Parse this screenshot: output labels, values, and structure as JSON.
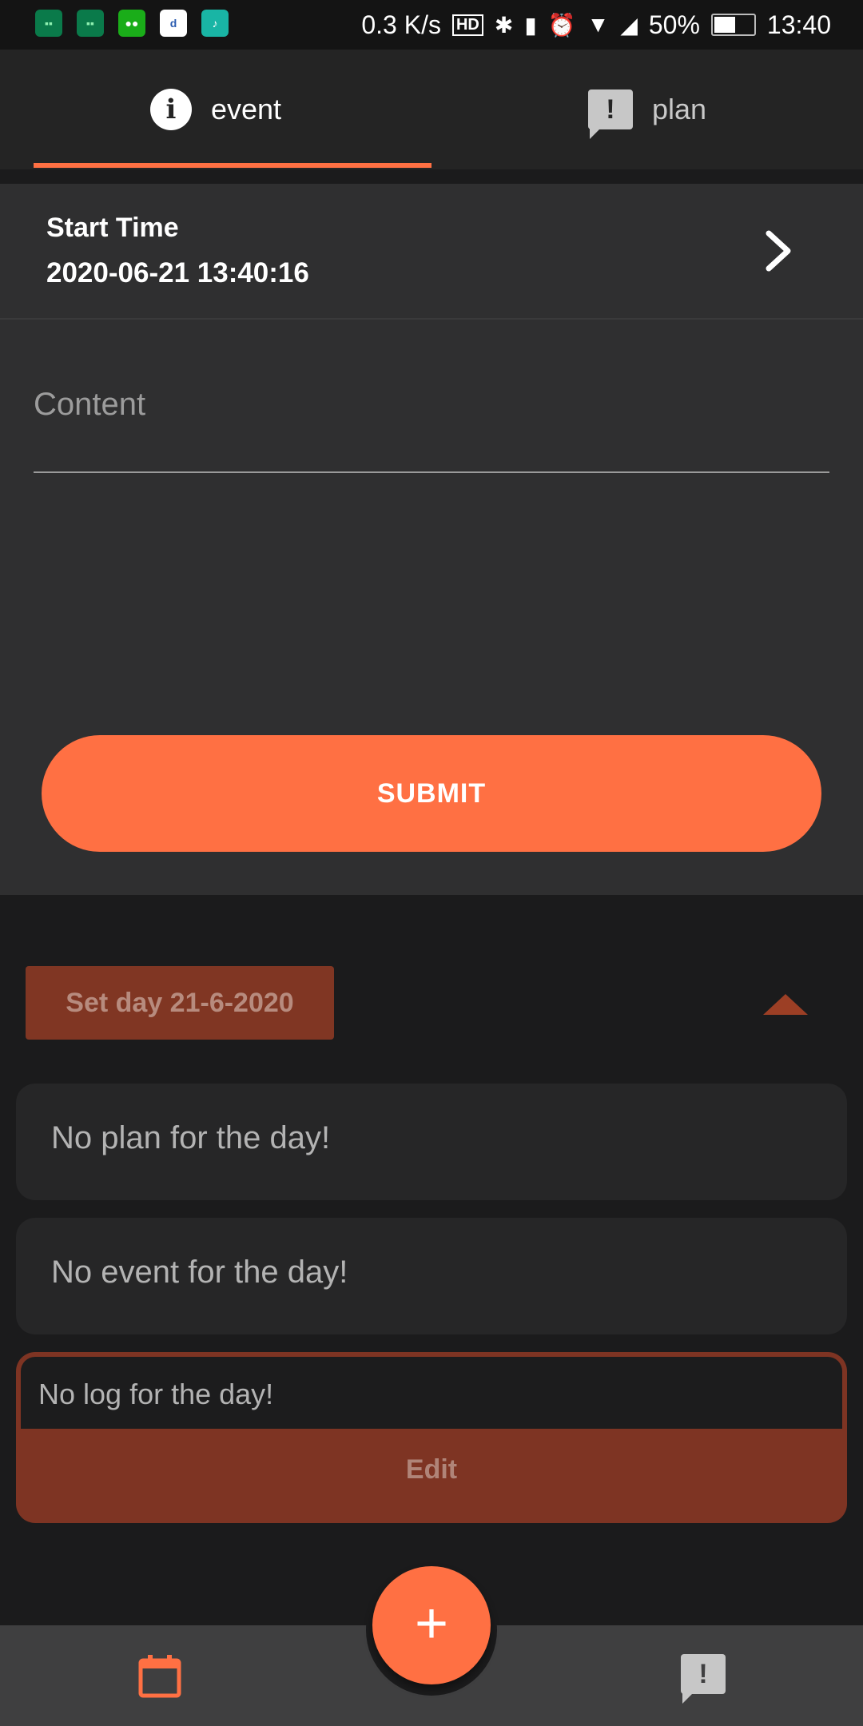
{
  "status_bar": {
    "speed": "0.3 K/s",
    "hd": "HD",
    "battery": "50%",
    "time": "13:40"
  },
  "tabs": [
    {
      "label": "event",
      "icon": "info-icon"
    },
    {
      "label": "plan",
      "icon": "alert-bubble-icon"
    }
  ],
  "form": {
    "start_label": "Start Time",
    "start_value": "2020-06-21 13:40:16",
    "content_placeholder": "Content",
    "submit_label": "SUBMIT"
  },
  "day": {
    "set_day_label": "Set day 21-6-2020",
    "plan_text": "No plan for the day!",
    "event_text": "No event for the day!",
    "log_text": "No log for the day!",
    "edit_label": "Edit"
  },
  "fab_label": "+",
  "colors": {
    "accent": "#ff7043",
    "accent_dark": "#7e3423",
    "background": "#1b1b1c"
  }
}
